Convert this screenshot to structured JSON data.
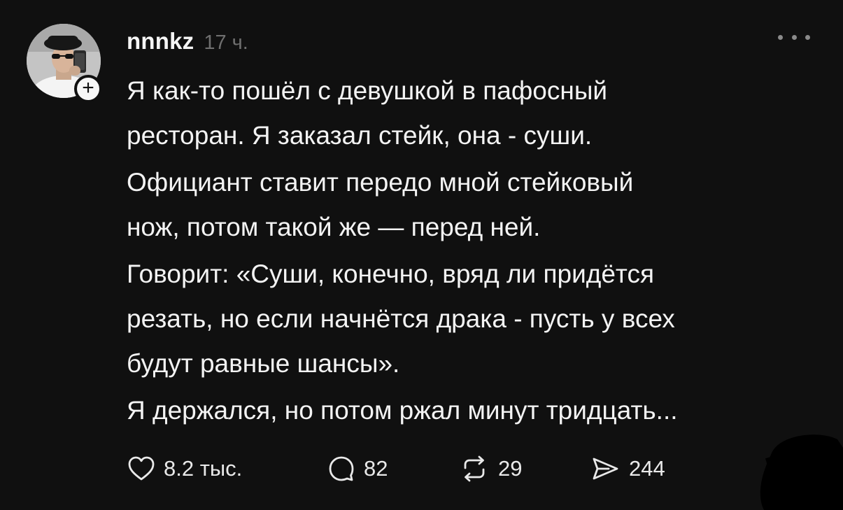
{
  "post": {
    "username": "nnnkz",
    "time": "17 ч.",
    "paragraphs": [
      [
        "Я как-то пошёл с девушкой в пафосный",
        "ресторан. Я заказал стейк, она - суши."
      ],
      [
        "Официант ставит передо мной стейковый",
        "нож, потом такой же — перед ней."
      ],
      [
        "Говорит: «Суши, конечно, вряд ли придётся",
        "резать, но если начнётся драка - пусть у всех",
        "будут равные шансы»."
      ],
      [
        "Я держался, но потом ржал минут тридцать..."
      ]
    ]
  },
  "actions": {
    "likes": "8.2 тыс.",
    "replies": "82",
    "reposts": "29",
    "shares": "244"
  },
  "icons": {
    "follow": "plus-icon",
    "more": "more-dots-icon",
    "like": "heart-icon",
    "reply": "comment-bubble-icon",
    "repost": "repost-arrows-icon",
    "share": "send-icon"
  },
  "colors": {
    "background": "#101010",
    "text": "#f3f3f3",
    "muted": "#6f6f6f"
  }
}
